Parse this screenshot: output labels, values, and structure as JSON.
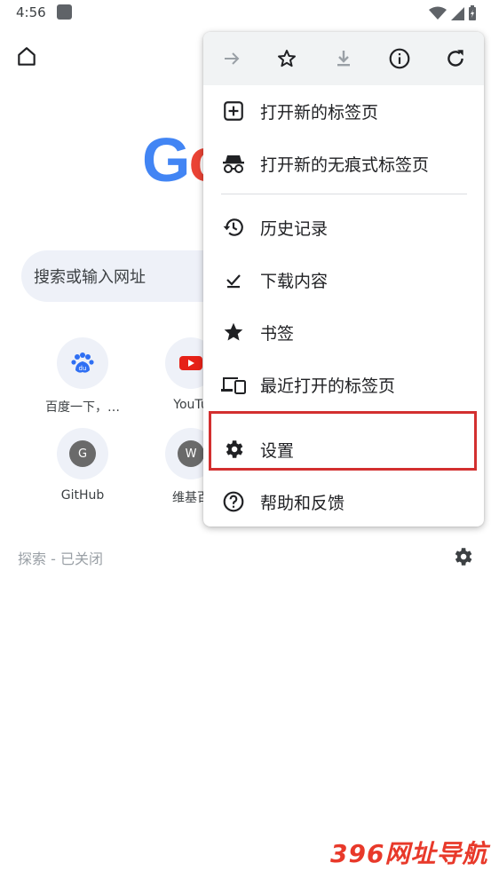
{
  "status_bar": {
    "time": "4:56"
  },
  "toolbar": {
    "home_icon": "home-icon"
  },
  "search": {
    "placeholder": "搜索或输入网址"
  },
  "tiles": [
    {
      "label": "百度一下，…",
      "icon": "baidu-icon"
    },
    {
      "label": "YouTu",
      "icon": "youtube-icon"
    },
    {
      "label": "GitHub",
      "letter": "G"
    },
    {
      "label": "维基百",
      "letter": "W"
    }
  ],
  "explore": {
    "label": "探索 - 已关闭"
  },
  "menu": {
    "top_icons": [
      "forward-icon",
      "bookmark-star-icon",
      "download-icon",
      "info-icon",
      "refresh-icon"
    ],
    "items": [
      {
        "label": "打开新的标签页",
        "icon": "new-tab-icon"
      },
      {
        "label": "打开新的无痕式标签页",
        "icon": "incognito-icon"
      },
      {
        "label": "历史记录",
        "icon": "history-icon"
      },
      {
        "label": "下载内容",
        "icon": "downloads-icon"
      },
      {
        "label": "书签",
        "icon": "bookmarks-icon"
      },
      {
        "label": "最近打开的标签页",
        "icon": "recent-tabs-icon"
      },
      {
        "label": "设置",
        "icon": "settings-icon"
      },
      {
        "label": "帮助和反馈",
        "icon": "help-icon"
      }
    ]
  },
  "highlight_color": "#d32f2f",
  "watermark": "396网址导航"
}
